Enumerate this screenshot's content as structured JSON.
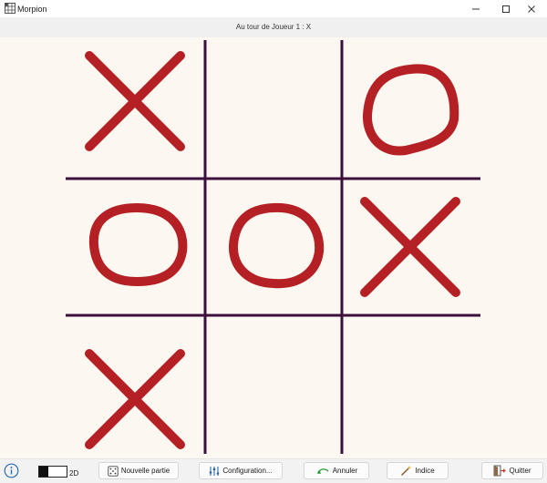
{
  "window": {
    "title": "Morpion",
    "controls": [
      "minimize-icon",
      "maximize-icon",
      "close-icon"
    ]
  },
  "status": {
    "text": "Au tour de Joueur 1 : X"
  },
  "board": {
    "cells": [
      "X",
      "",
      "O",
      "O",
      "O",
      "X",
      "X",
      "",
      ""
    ],
    "mark_color": "#b52024",
    "grid_color": "#3d0f3d"
  },
  "toolbar": {
    "info_icon": "info-icon",
    "view_toggle_label": "2D",
    "new_game_label": "Nouvelle partie",
    "config_label": "Configuration...",
    "undo_label": "Annuler",
    "hint_label": "Indice",
    "quit_label": "Quitter"
  }
}
